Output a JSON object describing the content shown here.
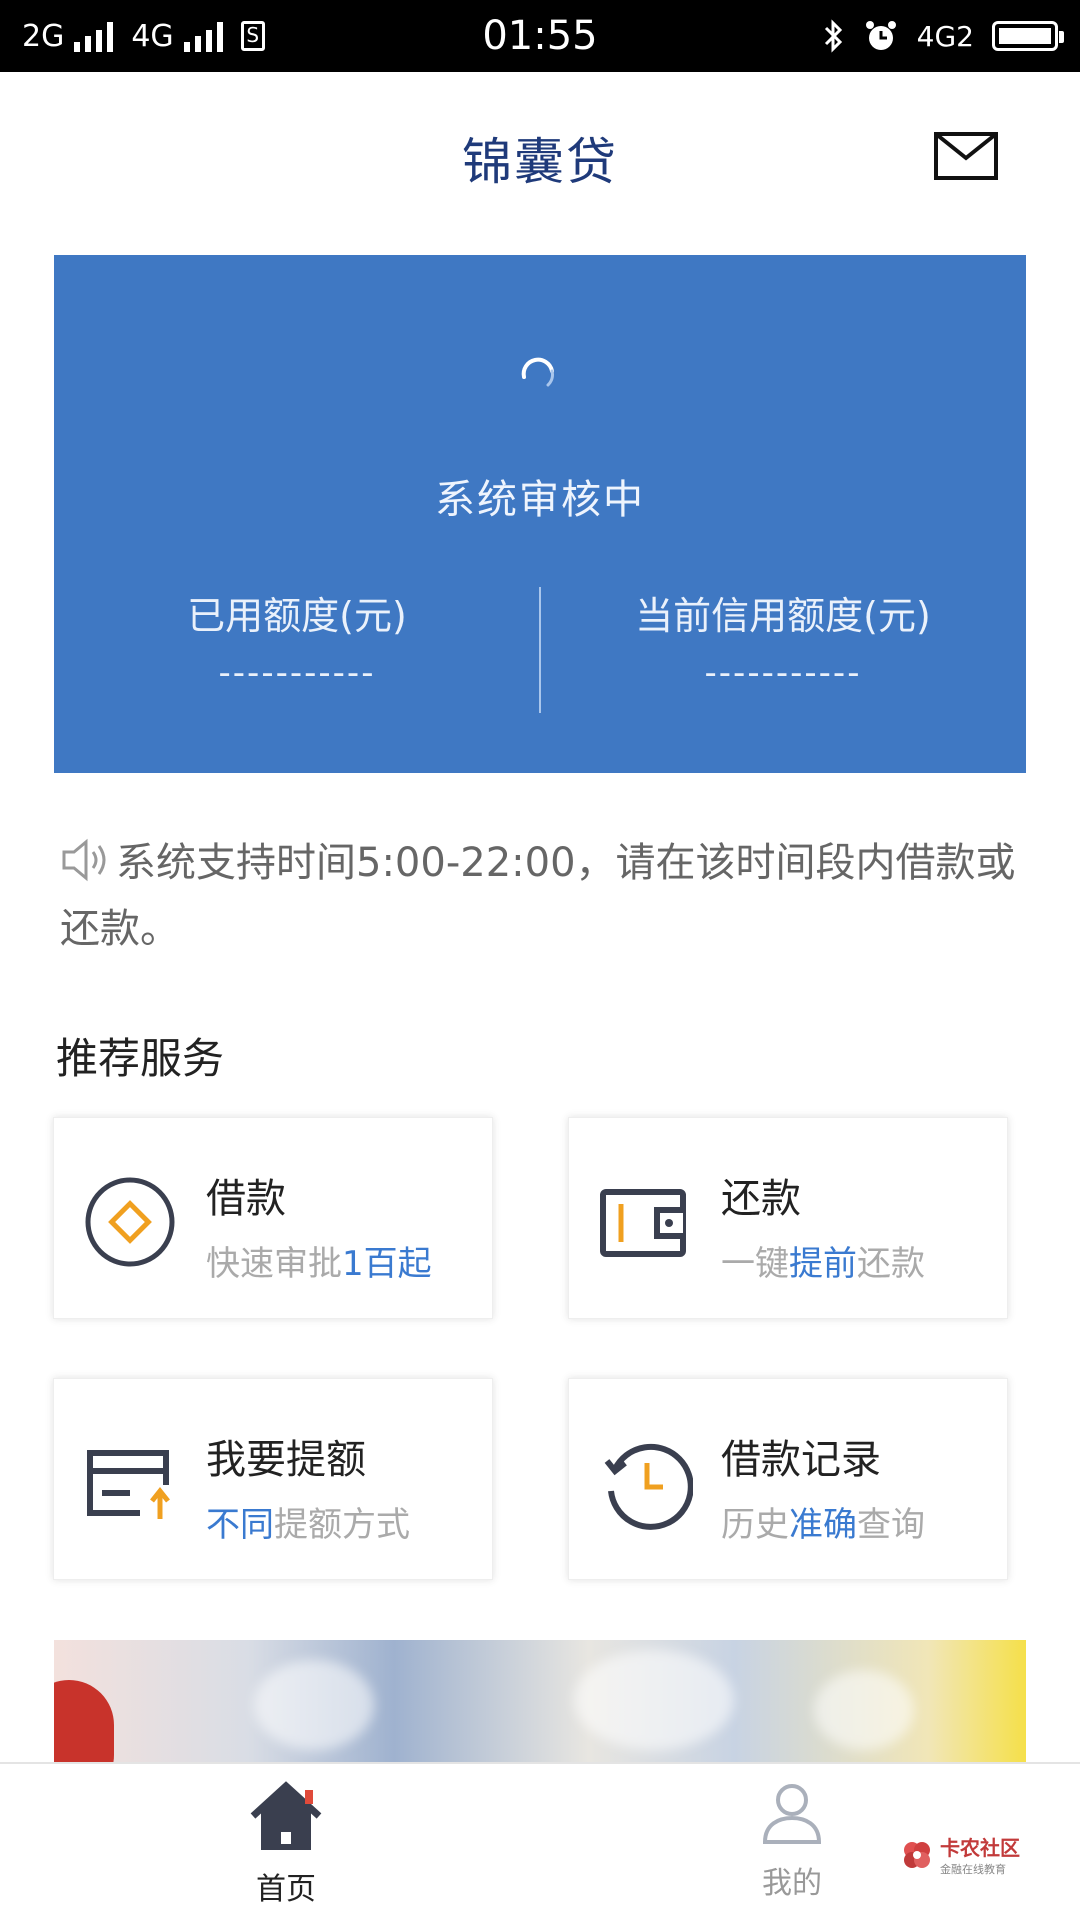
{
  "status_bar": {
    "network1": "2G",
    "network2": "4G",
    "time": "01:55",
    "mobile_data": "4G2"
  },
  "header": {
    "title": "锦囊贷"
  },
  "credit_card": {
    "status": "系统审核中",
    "used_label": "已用额度(元)",
    "used_value": "-----------",
    "current_label": "当前信用额度(元)",
    "current_value": "-----------"
  },
  "notice": {
    "text": "系统支持时间5:00-22:00，请在该时间段内借款或还款。"
  },
  "services": {
    "title": "推荐服务",
    "borrow": {
      "title": "借款",
      "sub_a": "快速审批",
      "sub_hl": "1百起",
      "sub_b": ""
    },
    "repay": {
      "title": "还款",
      "sub_a": "一键",
      "sub_hl": "提前",
      "sub_b": "还款"
    },
    "raise": {
      "title": "我要提额",
      "sub_a": "",
      "sub_hl": "不同",
      "sub_b": "提额方式"
    },
    "records": {
      "title": "借款记录",
      "sub_a": "历史",
      "sub_hl": "准确",
      "sub_b": "查询"
    }
  },
  "tabbar": {
    "home": "首页",
    "mine": "我的"
  },
  "watermark": {
    "name": "卡农社区",
    "tagline": "金融在线教育"
  },
  "colors": {
    "card_blue": "#3f78c3",
    "accent_orange": "#f0a020",
    "link_blue": "#3a7ad0",
    "title_navy": "#1f3a7a"
  }
}
